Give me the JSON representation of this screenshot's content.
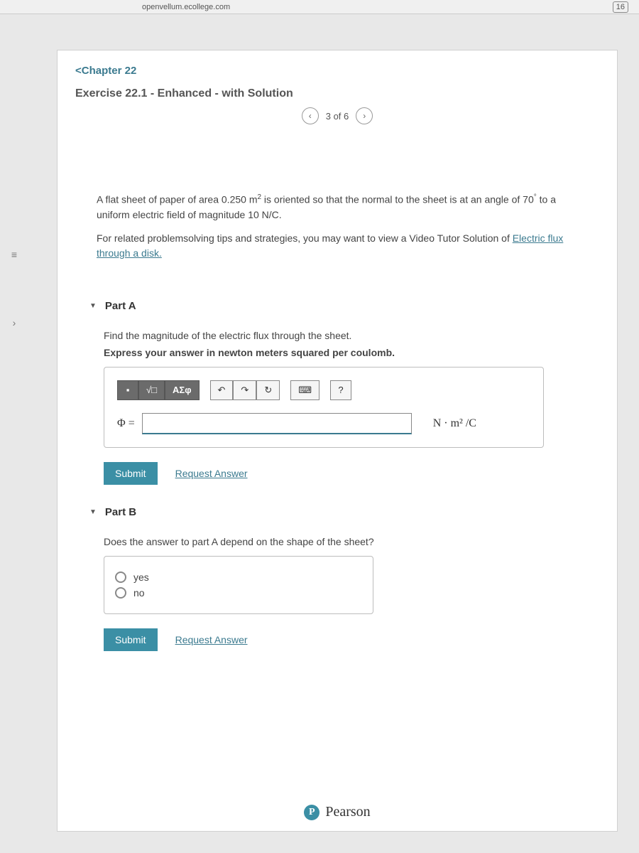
{
  "browser": {
    "url": "openvellum.ecollege.com",
    "tab_count": "16"
  },
  "nav": {
    "chapter": "<Chapter 22",
    "title": "Exercise 22.1 - Enhanced - with Solution",
    "page_label": "3 of 6"
  },
  "problem": {
    "line1_a": "A flat sheet of paper of area 0.250 m",
    "line1_b": " is oriented so that the normal to the sheet is at an angle of 70",
    "line1_c": " to a uniform electric field of magnitude 10 N/C.",
    "line2": "For related problemsolving tips and strategies, you may want to view a Video Tutor Solution of ",
    "link": "Electric flux through a disk."
  },
  "partA": {
    "header": "Part A",
    "instruction1": "Find the magnitude of the electric flux through the sheet.",
    "instruction2": "Express your answer in newton meters squared per coulomb.",
    "greek_btn": "ΑΣφ",
    "formula_label": "Φ =",
    "units": "N · m² /C",
    "submit": "Submit",
    "request": "Request Answer",
    "help": "?"
  },
  "partB": {
    "header": "Part B",
    "question": "Does the answer to part A depend on the shape of the sheet?",
    "option1": "yes",
    "option2": "no",
    "submit": "Submit",
    "request": "Request Answer"
  },
  "footer": {
    "brand": "Pearson",
    "logo": "P"
  }
}
